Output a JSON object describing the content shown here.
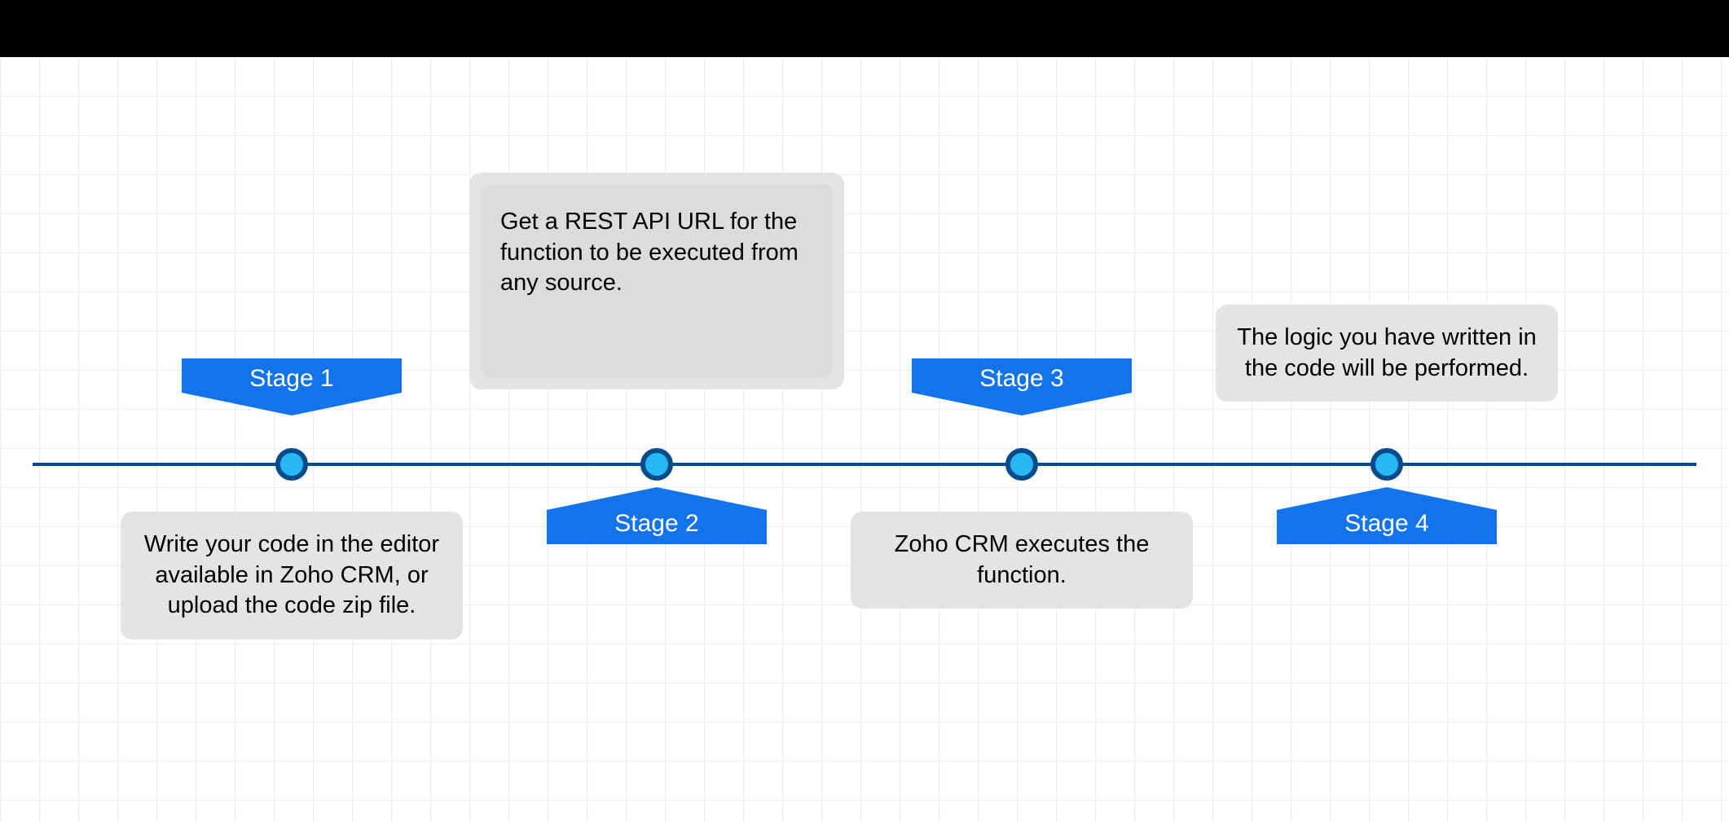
{
  "stages": [
    {
      "label": "Stage 1",
      "description": "Write your code in the editor available in Zoho CRM, or upload the code zip file.",
      "flag_orientation": "down",
      "box_position": "below"
    },
    {
      "label": "Stage 2",
      "description": "Get a REST API URL for the function to be executed from any source.",
      "flag_orientation": "up",
      "box_position": "above"
    },
    {
      "label": "Stage 3",
      "description": "Zoho CRM executes the function.",
      "flag_orientation": "down",
      "box_position": "below"
    },
    {
      "label": "Stage 4",
      "description": "The logic you have written in the code will be performed.",
      "flag_orientation": "up",
      "box_position": "above"
    }
  ]
}
